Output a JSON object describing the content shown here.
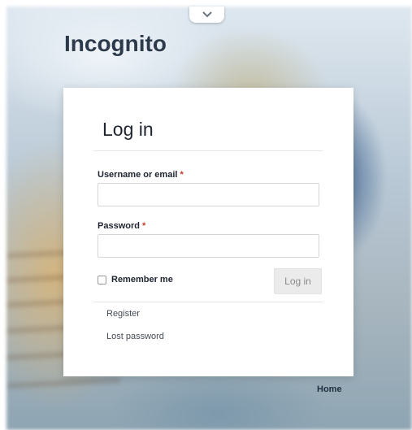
{
  "site": {
    "title": "Incognito"
  },
  "form": {
    "heading": "Log in",
    "username": {
      "label": "Username or email",
      "required_mark": "*",
      "value": "",
      "placeholder": ""
    },
    "password": {
      "label": "Password",
      "required_mark": "*",
      "value": "",
      "placeholder": ""
    },
    "remember": {
      "label": "Remember me",
      "checked": false
    },
    "submit_label": "Log in"
  },
  "links": {
    "register": "Register",
    "lost_password": "Lost password"
  },
  "footer": {
    "home_label": "Home"
  },
  "icons": {
    "top_tab": "chevron-down-icon"
  },
  "colors": {
    "title": "#2c3a4b",
    "required": "#c0392b",
    "button_bg": "#ebebeb"
  }
}
